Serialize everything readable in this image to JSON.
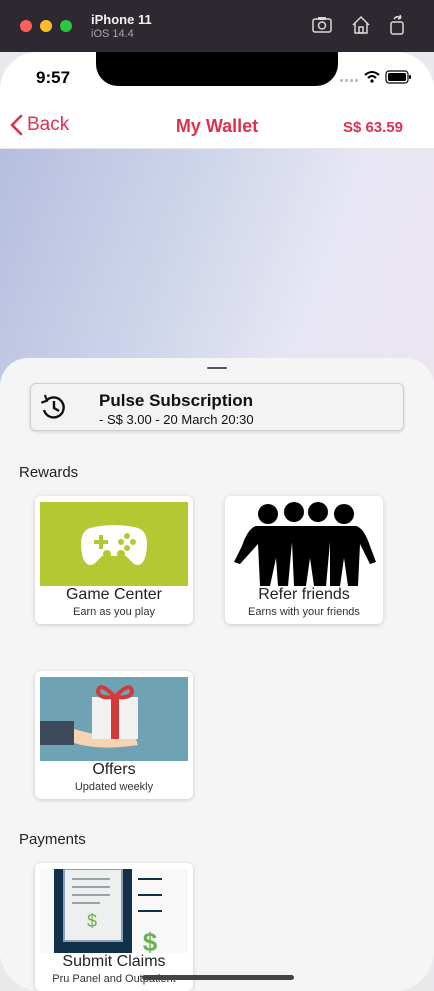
{
  "simulator": {
    "device": "iPhone 11",
    "os": "iOS 14.4"
  },
  "status_bar": {
    "time": "9:57"
  },
  "nav": {
    "back_label": "Back",
    "title": "My Wallet",
    "balance": "S$ 63.59"
  },
  "transaction": {
    "title": "Pulse Subscription",
    "detail": "- S$ 3.00 - 20 March 20:30",
    "icon": "history-icon"
  },
  "rewards": {
    "heading": "Rewards",
    "cards": [
      {
        "title": "Game Center",
        "subtitle": "Earn as you play",
        "icon": "gamepad-icon"
      },
      {
        "title": "Refer friends",
        "subtitle": "Earns with your friends",
        "icon": "friends-icon"
      },
      {
        "title": "Offers",
        "subtitle": "Updated weekly",
        "icon": "gift-icon"
      }
    ]
  },
  "payments": {
    "heading": "Payments",
    "cards": [
      {
        "title": "Submit Claims",
        "subtitle": "Pru Panel and Outpatient",
        "icon": "receipt-icon"
      }
    ]
  },
  "colors": {
    "accent": "#e03050",
    "game_bg": "#b4c834",
    "offers_bg": "#6fa3b3",
    "claims_bg": "#13304a"
  }
}
